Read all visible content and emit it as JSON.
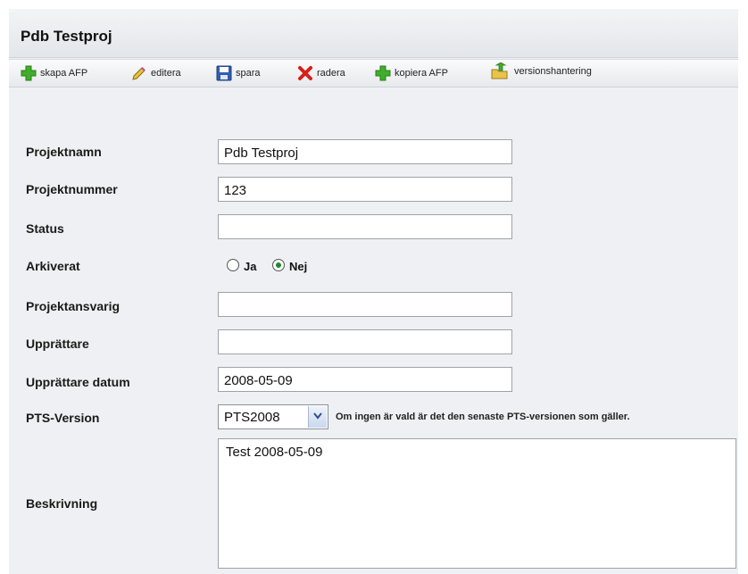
{
  "header": {
    "title": "Pdb Testproj"
  },
  "toolbar": {
    "items": [
      {
        "label": "skapa AFP",
        "icon": "plus-icon"
      },
      {
        "label": "editera",
        "icon": "pencil-icon"
      },
      {
        "label": "spara",
        "icon": "floppy-disk-icon"
      },
      {
        "label": "radera",
        "icon": "delete-x-icon"
      },
      {
        "label": "kopiera AFP",
        "icon": "plus-icon"
      },
      {
        "label": "versionshantering",
        "icon": "folder-arrow-icon"
      }
    ]
  },
  "form": {
    "projektnamn": {
      "label": "Projektnamn",
      "value": "Pdb Testproj"
    },
    "projektnummer": {
      "label": "Projektnummer",
      "value": "123"
    },
    "status": {
      "label": "Status",
      "value": ""
    },
    "arkiverat": {
      "label": "Arkiverat",
      "options": [
        "Ja",
        "Nej"
      ],
      "selected": "Nej"
    },
    "projektansvarig": {
      "label": "Projektansvarig",
      "value": ""
    },
    "upprattare": {
      "label": "Upprättare",
      "value": ""
    },
    "upprattare_datum": {
      "label": "Upprättare datum",
      "value": "2008-05-09"
    },
    "pts_version": {
      "label": "PTS-Version",
      "value": "PTS2008",
      "hint": "Om ingen är vald är det den senaste PTS-versionen som gäller."
    },
    "beskrivning": {
      "label": "Beskrivning",
      "value": "Test 2008-05-09"
    }
  },
  "colors": {
    "panel_bg": "#eef0f3",
    "icon_green": "#3fae2a",
    "icon_red": "#d6201a",
    "icon_blue": "#2f5fb3",
    "radio_selected": "#1a8a2a"
  }
}
